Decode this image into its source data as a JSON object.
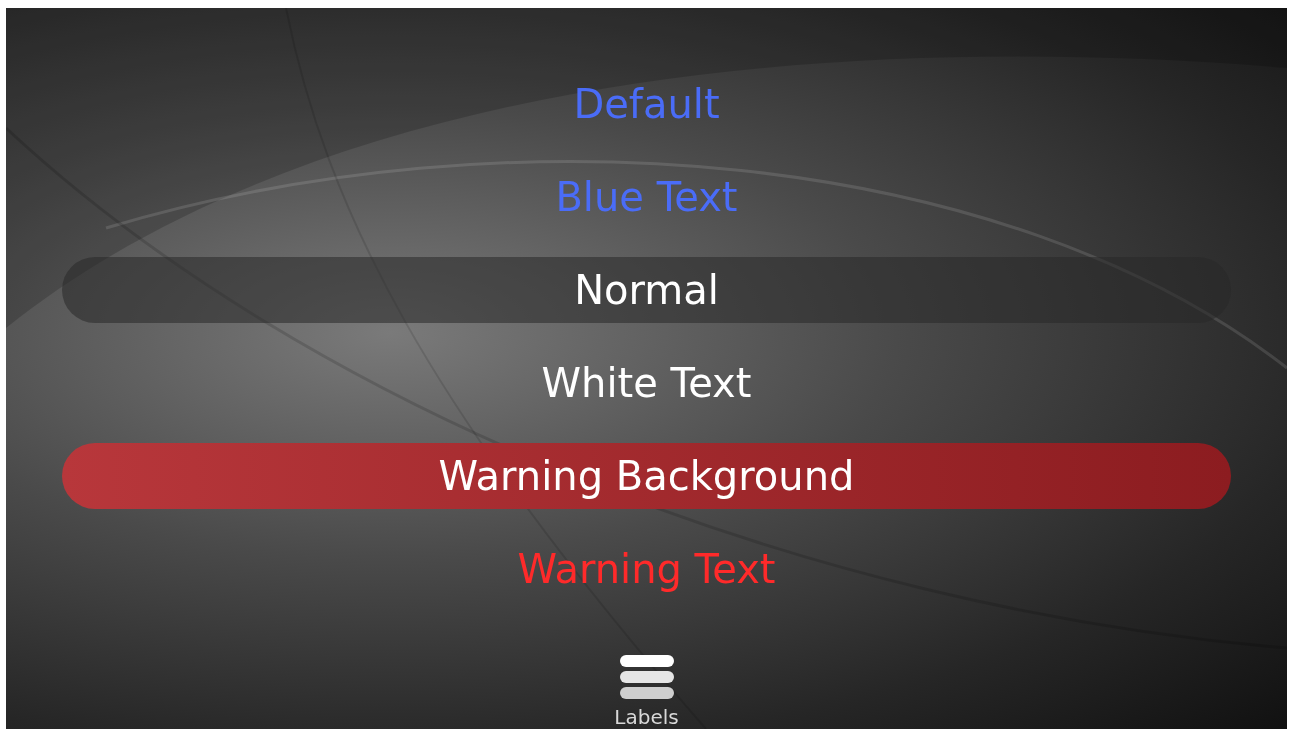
{
  "labels": [
    {
      "kind": "default",
      "text": "Default"
    },
    {
      "kind": "blue",
      "text": "Blue Text"
    },
    {
      "kind": "normal",
      "text": "Normal"
    },
    {
      "kind": "white",
      "text": "White Text"
    },
    {
      "kind": "warning_background",
      "text": "Warning Background"
    },
    {
      "kind": "warning_text",
      "text": "Warning Text"
    }
  ],
  "tab_bar": {
    "items": [
      {
        "label": "Labels",
        "selected": true
      }
    ]
  }
}
